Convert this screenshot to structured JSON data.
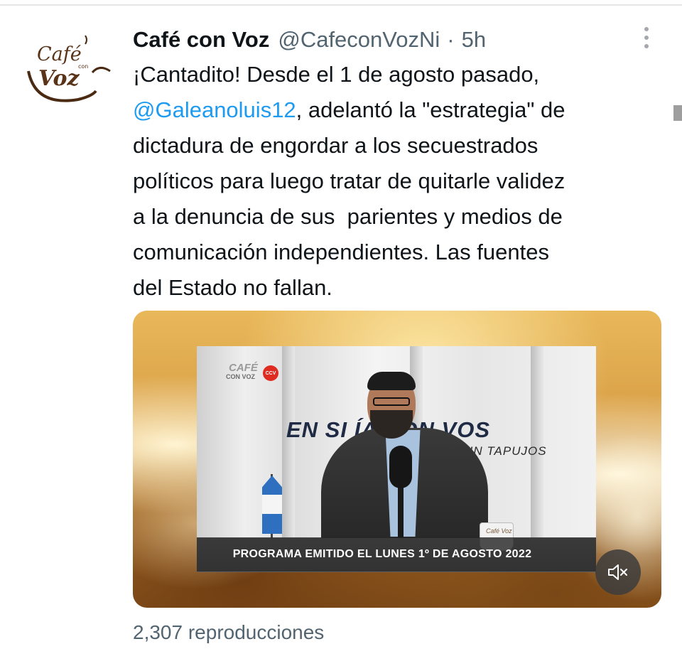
{
  "tweet": {
    "author_name": "Café con Voz",
    "handle": "@CafeconVozNi",
    "separator": "·",
    "time": "5h",
    "avatar": {
      "logo_word_1": "Café",
      "logo_word_small": "con",
      "logo_word_2": "Voz"
    },
    "text_lines": [
      {
        "before": "¡Cantadito! Desde el 1 de agosto pasado,",
        "mention": "",
        "after": ""
      },
      {
        "before": "",
        "mention": "@Galeanoluis12",
        "after": ", adelantó la \"estrategia\" de"
      },
      {
        "before": "dictadura de engordar a los secuestrados",
        "mention": "",
        "after": ""
      },
      {
        "before": "políticos para luego tratar de quitarle validez",
        "mention": "",
        "after": ""
      },
      {
        "before": "a la denuncia de sus  parientes y medios de",
        "mention": "",
        "after": ""
      },
      {
        "before": "comunicación independientes. Las fuentes",
        "mention": "",
        "after": ""
      },
      {
        "before": "del Estado no fallan.",
        "mention": "",
        "after": ""
      }
    ],
    "mention_color": "#1d9bf0",
    "media": {
      "video_logo_top": "CAFÉ",
      "video_logo_bottom": "CON VOZ",
      "video_logo_badge": "CCV",
      "show_title": "EN SI    ÍA CON VOS",
      "show_subtitle": "RE SIN TAPUJOS",
      "mug_text": "Café Voz",
      "caption": "PROGRAMA EMITIDO EL LUNES 1º DE AGOSTO 2022",
      "mute_icon": "volume-muted-icon"
    },
    "views": {
      "count": "2,307",
      "label": "reproducciones"
    }
  },
  "colors": {
    "text": "#0f1419",
    "secondary": "#536471",
    "logo_brown": "#5a3418"
  }
}
